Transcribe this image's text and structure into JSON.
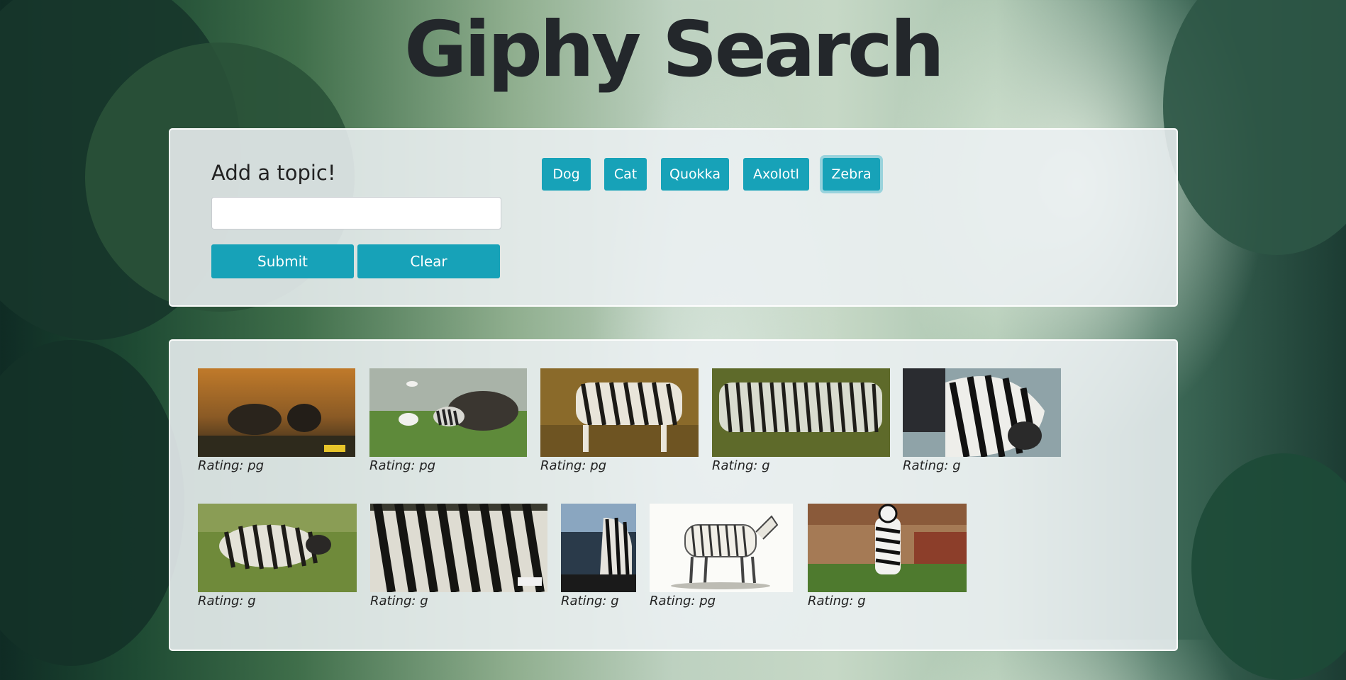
{
  "page": {
    "title": "Giphy Search"
  },
  "form": {
    "label": "Add a topic!",
    "input_value": "",
    "input_placeholder": "",
    "submit_label": "Submit",
    "clear_label": "Clear"
  },
  "topics": [
    {
      "label": "Dog",
      "active": false
    },
    {
      "label": "Cat",
      "active": false
    },
    {
      "label": "Quokka",
      "active": false
    },
    {
      "label": "Axolotl",
      "active": false
    },
    {
      "label": "Zebra",
      "active": true
    }
  ],
  "results": [
    {
      "rating": "Rating: pg",
      "scene": "zebras-sunset"
    },
    {
      "rating": "Rating: pg",
      "scene": "zebras-buffalo-egret"
    },
    {
      "rating": "Rating: pg",
      "scene": "zebra-grazing"
    },
    {
      "rating": "Rating: g",
      "scene": "zebra-herd"
    },
    {
      "rating": "Rating: g",
      "scene": "zebra-closeup-car"
    },
    {
      "rating": "Rating: g",
      "scene": "zebra-running"
    },
    {
      "rating": "Rating: g",
      "scene": "zebra-stripes-closeup"
    },
    {
      "rating": "Rating: g",
      "scene": "zebra-car-window"
    },
    {
      "rating": "Rating: pg",
      "scene": "zebra-illustration"
    },
    {
      "rating": "Rating: g",
      "scene": "person-zebra-costume"
    }
  ],
  "colors": {
    "button": "#17a2b8",
    "title": "#23272b"
  }
}
